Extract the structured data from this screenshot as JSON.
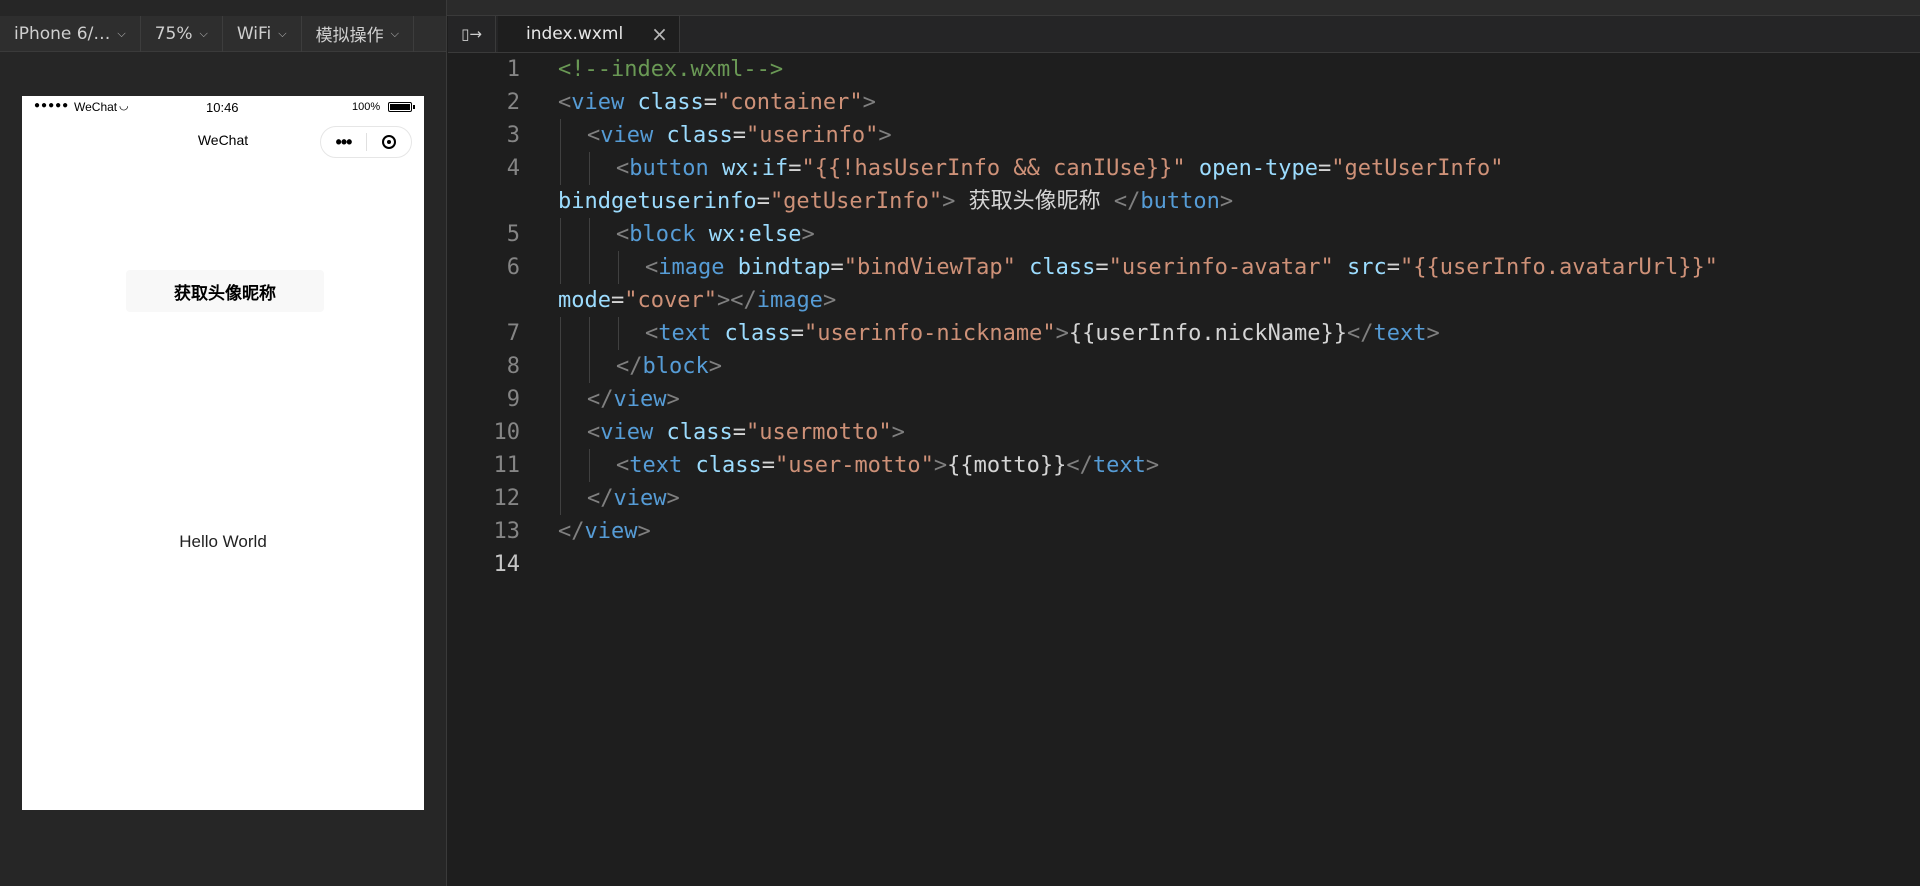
{
  "toolbar": {
    "device": "iPhone 6/…",
    "zoom": "75%",
    "network": "WiFi",
    "simulate": "模拟操作",
    "pane_toggle_icon": "split-pane-icon"
  },
  "phone": {
    "status": {
      "carrier": "WeChat",
      "time": "10:46",
      "battery": "100%"
    },
    "nav_title": "WeChat",
    "userinfo_button": "获取头像昵称",
    "motto": "Hello World"
  },
  "editor": {
    "tab_name": "index.wxml",
    "tab_close": "×",
    "line_numbers": [
      "1",
      "2",
      "3",
      "4",
      "5",
      "6",
      "7",
      "8",
      "9",
      "10",
      "11",
      "12",
      "13",
      "14"
    ],
    "code": {
      "l1": "<!--index.wxml-->",
      "l2": {
        "tag": "view",
        "attr": "class",
        "val": "\"container\""
      },
      "l3": {
        "tag": "view",
        "attr": "class",
        "val": "\"userinfo\""
      },
      "l4": {
        "tag": "button",
        "attr1": "wx:if",
        "val1": "\"{{!hasUserInfo && canIUse}}\"",
        "attr2": "open-type",
        "val2": "\"getUserInfo\""
      },
      "l4b": {
        "attr": "bindgetuserinfo",
        "val": "\"getUserInfo\"",
        "text": " 获取头像昵称 ",
        "close": "button"
      },
      "l5": {
        "tag": "block",
        "attr": "wx:else"
      },
      "l6": {
        "tag": "image",
        "attr1": "bindtap",
        "val1": "\"bindViewTap\"",
        "attr2": "class",
        "val2": "\"userinfo-avatar\"",
        "attr3": "src",
        "val3": "\"{{userInfo.avatarUrl}}\""
      },
      "l6b": {
        "attr": "mode",
        "val": "\"cover\"",
        "close": "image"
      },
      "l7": {
        "tag": "text",
        "attr": "class",
        "val": "\"userinfo-nickname\"",
        "text": "{{userInfo.nickName}}",
        "close": "text"
      },
      "l8": {
        "close": "block"
      },
      "l9": {
        "close": "view"
      },
      "l10": {
        "tag": "view",
        "attr": "class",
        "val": "\"usermotto\""
      },
      "l11": {
        "tag": "text",
        "attr": "class",
        "val": "\"user-motto\"",
        "text": "{{motto}}",
        "close": "text"
      },
      "l12": {
        "close": "view"
      },
      "l13": {
        "close": "view"
      }
    }
  },
  "colors": {
    "editor_bg": "#1e1e1e",
    "comment": "#6a9955",
    "tag": "#569cd6",
    "attribute": "#9cdcfe",
    "string": "#ce9178",
    "punctuation": "#808080"
  }
}
